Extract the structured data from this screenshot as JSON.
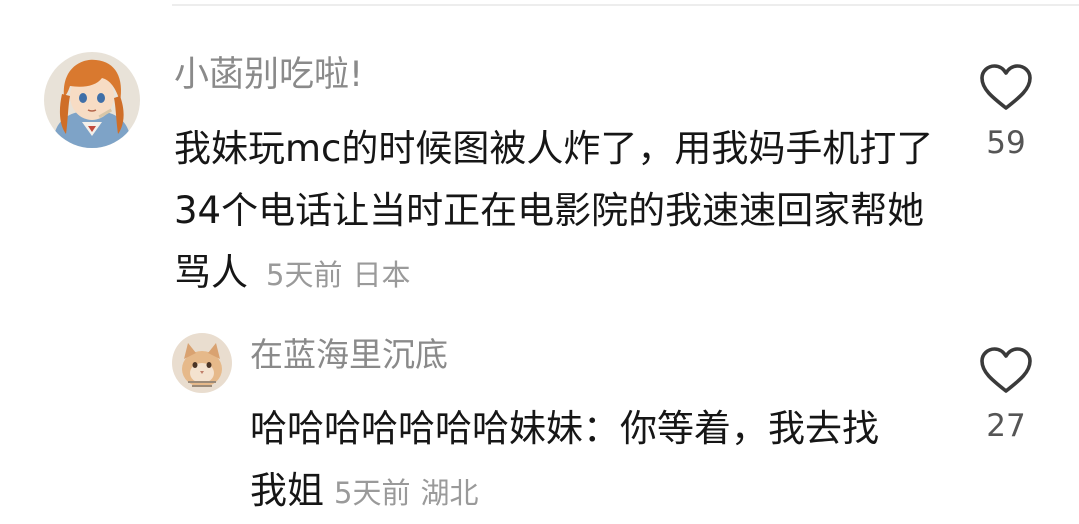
{
  "comment": {
    "username": "小菡别吃啦!",
    "text": "我妹玩mc的时候图被人炸了，用我妈手机打了34个电话让当时正在电影院的我速速回家帮她骂人",
    "time": "5天前",
    "location": "日本",
    "like_count": "59",
    "avatar_icon": "anime-girl-avatar"
  },
  "reply": {
    "username": "在蓝海里沉底",
    "text": "哈哈哈哈哈哈哈妹妹：你等着，我去找我姐",
    "time": "5天前",
    "location": "湖北",
    "like_count": "27",
    "avatar_icon": "cat-avatar"
  },
  "colors": {
    "username": "#8a8a8a",
    "text": "#161616",
    "meta": "#9a9a9a",
    "heart_outline": "#3a3a3a"
  }
}
